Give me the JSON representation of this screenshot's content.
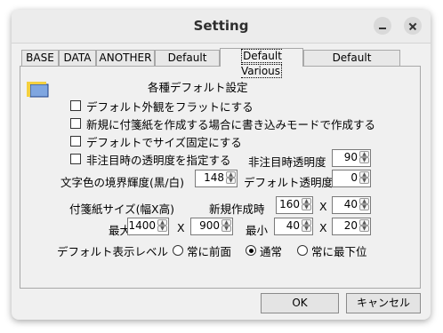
{
  "window": {
    "title": "Setting"
  },
  "tabs": [
    "BASE",
    "DATA",
    "ANOTHER",
    "Default Link",
    "Default Various",
    "Default Font/Color"
  ],
  "section_title": "各種デフォルト設定",
  "checkboxes": [
    {
      "label": "デフォルト外観をフラットにする",
      "checked": false
    },
    {
      "label": "新規に付箋紙を作成する場合に書き込みモードで作成する",
      "checked": false
    },
    {
      "label": "デフォルトでサイズ固定にする",
      "checked": false
    },
    {
      "label": "非注目時の透明度を指定する",
      "checked": false
    }
  ],
  "inactive_opacity": {
    "label": "非注目時透明度",
    "value": "90"
  },
  "text_border_brightness": {
    "label": "文字色の境界輝度(黒/白)",
    "value": "148"
  },
  "default_opacity": {
    "label": "デフォルト透明度",
    "value": "0"
  },
  "note_size": {
    "label": "付箋紙サイズ(幅X高)",
    "new_label": "新規作成時",
    "new_w": "160",
    "new_h": "40",
    "max_label": "最大",
    "max_w": "1400",
    "max_h": "900",
    "min_label": "最小",
    "min_w": "40",
    "min_h": "20",
    "x_sep": "X"
  },
  "display_level": {
    "label": "デフォルト表示レベル",
    "options": [
      "常に前面",
      "通常",
      "常に最下位"
    ],
    "selected": "通常"
  },
  "buttons": {
    "ok": "OK",
    "cancel": "キャンセル"
  }
}
